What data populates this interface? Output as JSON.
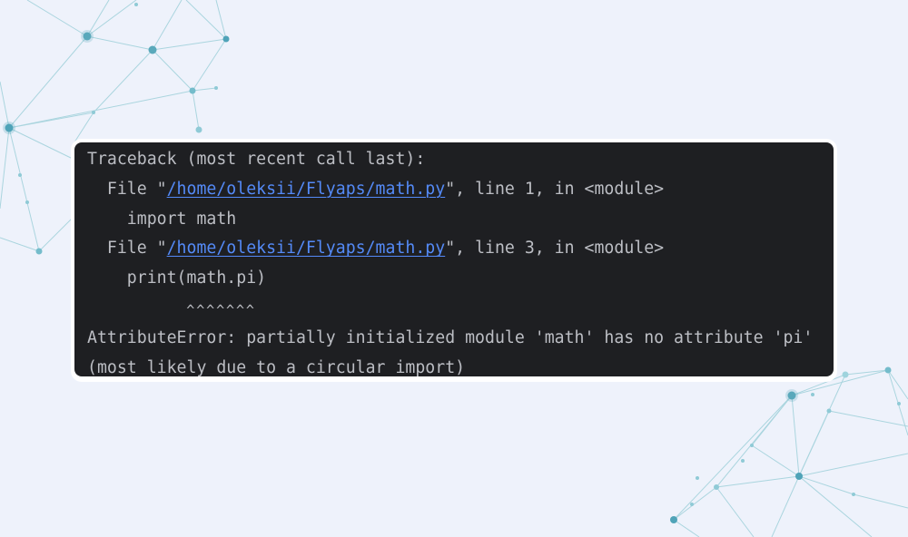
{
  "traceback": {
    "header": "Traceback (most recent call last):",
    "frames": [
      {
        "prefix": "  File \"",
        "path": "/home/oleksii/Flyaps/math.py",
        "suffix": "\", line 1, in <module>",
        "code": "    import math"
      },
      {
        "prefix": "  File \"",
        "path": "/home/oleksii/Flyaps/math.py",
        "suffix": "\", line 3, in <module>",
        "code": "    print(math.pi)",
        "carets": "          ^^^^^^^"
      }
    ],
    "error_line": "AttributeError: partially initialized module 'math' has no attribute 'pi'",
    "note_line": "(most likely due to a circular import)"
  },
  "colors": {
    "page_background": "#eef2fb",
    "terminal_background": "#1e1f22",
    "text": "#bcbec4",
    "link": "#548af7",
    "network_node": "#4fa3b8"
  }
}
